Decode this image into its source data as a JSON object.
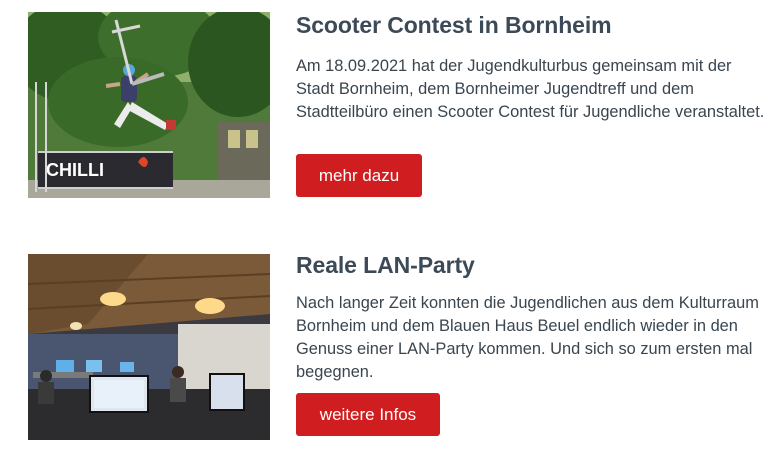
{
  "articles": [
    {
      "title": "Scooter Contest in Bornheim",
      "text": "Am 18.09.2021 hat der Jugendkulturbus gemeinsam mit der Stadt Bornheim, dem Bornheimer Jugendtreff und dem Stadtteilbüro einen Scooter Contest für Jugendliche veranstaltet.",
      "button_label": "mehr dazu",
      "image_banner_text": "CHILLI"
    },
    {
      "title": "Reale LAN-Party",
      "text": "Nach langer Zeit konnten die Jugendlichen aus dem Kulturraum Bornheim und dem Blauen Haus Beuel endlich wieder in den Genuss einer LAN-Party kommen. Und sich so zum ersten mal begegnen.",
      "button_label": "weitere Infos"
    }
  ],
  "colors": {
    "button": "#d01d1f",
    "heading": "#3c4a57",
    "text": "#39454f"
  }
}
